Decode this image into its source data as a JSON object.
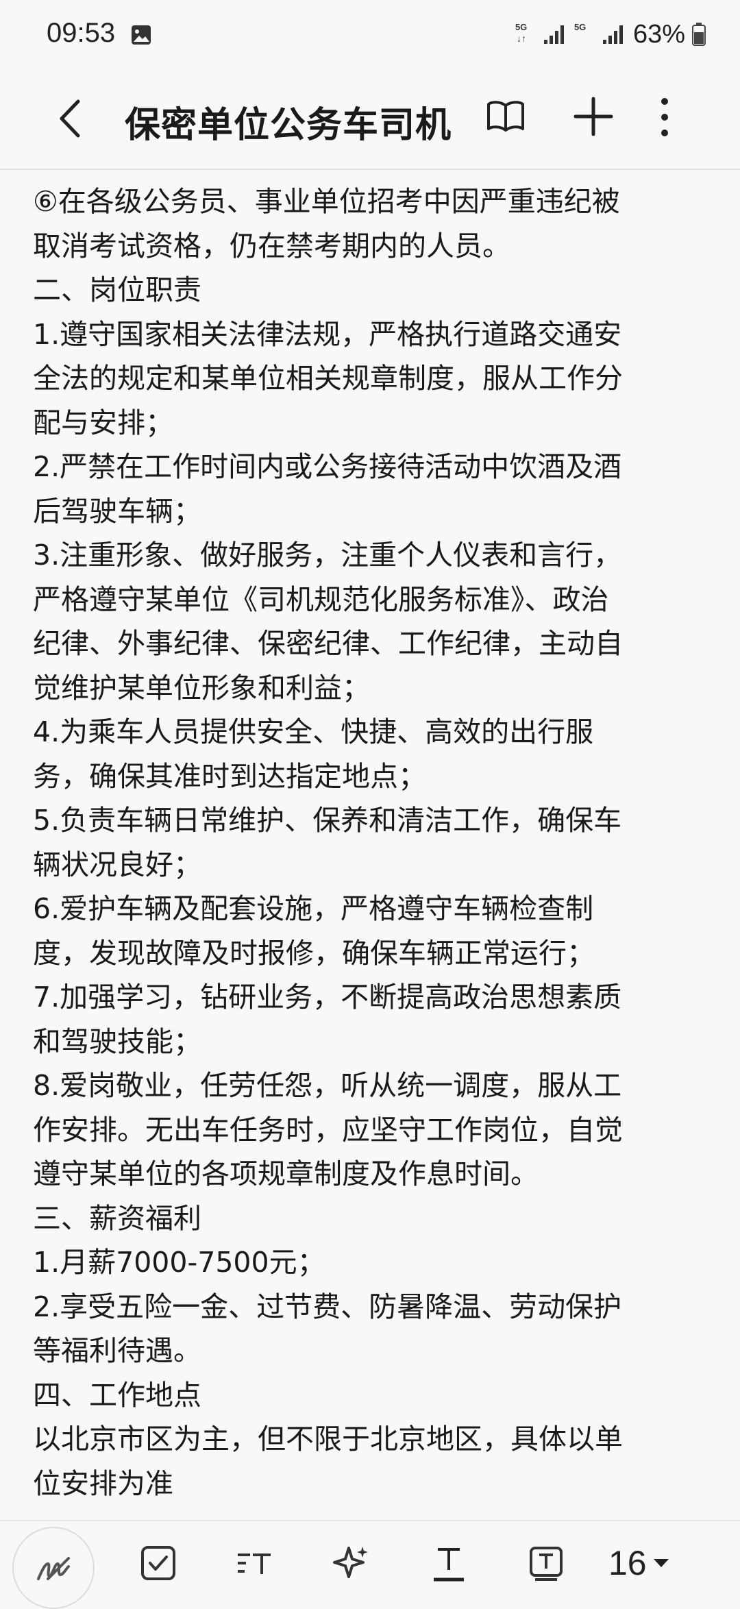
{
  "status_bar": {
    "time": "09:53",
    "net_type_1": "5G",
    "net_type_2": "5G",
    "battery": "63%",
    "icons": [
      "gallery-icon",
      "signal-icon",
      "signal-icon",
      "battery-icon"
    ]
  },
  "header": {
    "title": "保密单位公务车司机",
    "icons": [
      "back-arrow-icon",
      "reader-mode-icon",
      "plus-icon",
      "more-vertical-icon"
    ]
  },
  "content": {
    "lines": [
      "⑥在各级公务员、事业单位招考中因严重违纪被",
      "取消考试资格，仍在禁考期内的人员。",
      "二、岗位职责",
      "1.遵守国家相关法律法规，严格执行道路交通安",
      "全法的规定和某单位相关规章制度，服从工作分",
      "配与安排；",
      "2.严禁在工作时间内或公务接待活动中饮酒及酒",
      "后驾驶车辆；",
      "3.注重形象、做好服务，注重个人仪表和言行，",
      "严格遵守某单位《司机规范化服务标准》、政治",
      "纪律、外事纪律、保密纪律、工作纪律，主动自",
      "觉维护某单位形象和利益；",
      "4.为乘车人员提供安全、快捷、高效的出行服",
      "务，确保其准时到达指定地点；",
      "5.负责车辆日常维护、保养和清洁工作，确保车",
      "辆状况良好；",
      "6.爱护车辆及配套设施，严格遵守车辆检查制",
      "度，发现故障及时报修，确保车辆正常运行；",
      "7.加强学习，钻研业务，不断提高政治思想素质",
      "和驾驶技能；",
      "8.爱岗敬业，任劳任怨，听从统一调度，服从工",
      "作安排。无出车任务时，应坚守工作岗位，自觉",
      "遵守某单位的各项规章制度及作息时间。",
      "三、薪资福利",
      "1.月薪7000-7500元；",
      "2.享受五险一金、过节费、防暑降温、劳动保护",
      "等福利待遇。",
      "四、工作地点",
      "以北京市区为主，但不限于北京地区，具体以单",
      "位安排为准"
    ]
  },
  "toolbar": {
    "font_size": "16",
    "icons": [
      "handwriting-pen-icon",
      "checkbox-icon",
      "text-format-icon",
      "ai-sparkle-icon",
      "text-style-icon",
      "text-box-icon",
      "dropdown-arrow-icon"
    ]
  },
  "colors": {
    "background": "#f8f8f8",
    "text": "#1a1a1a",
    "divider": "#e2e2e2"
  }
}
